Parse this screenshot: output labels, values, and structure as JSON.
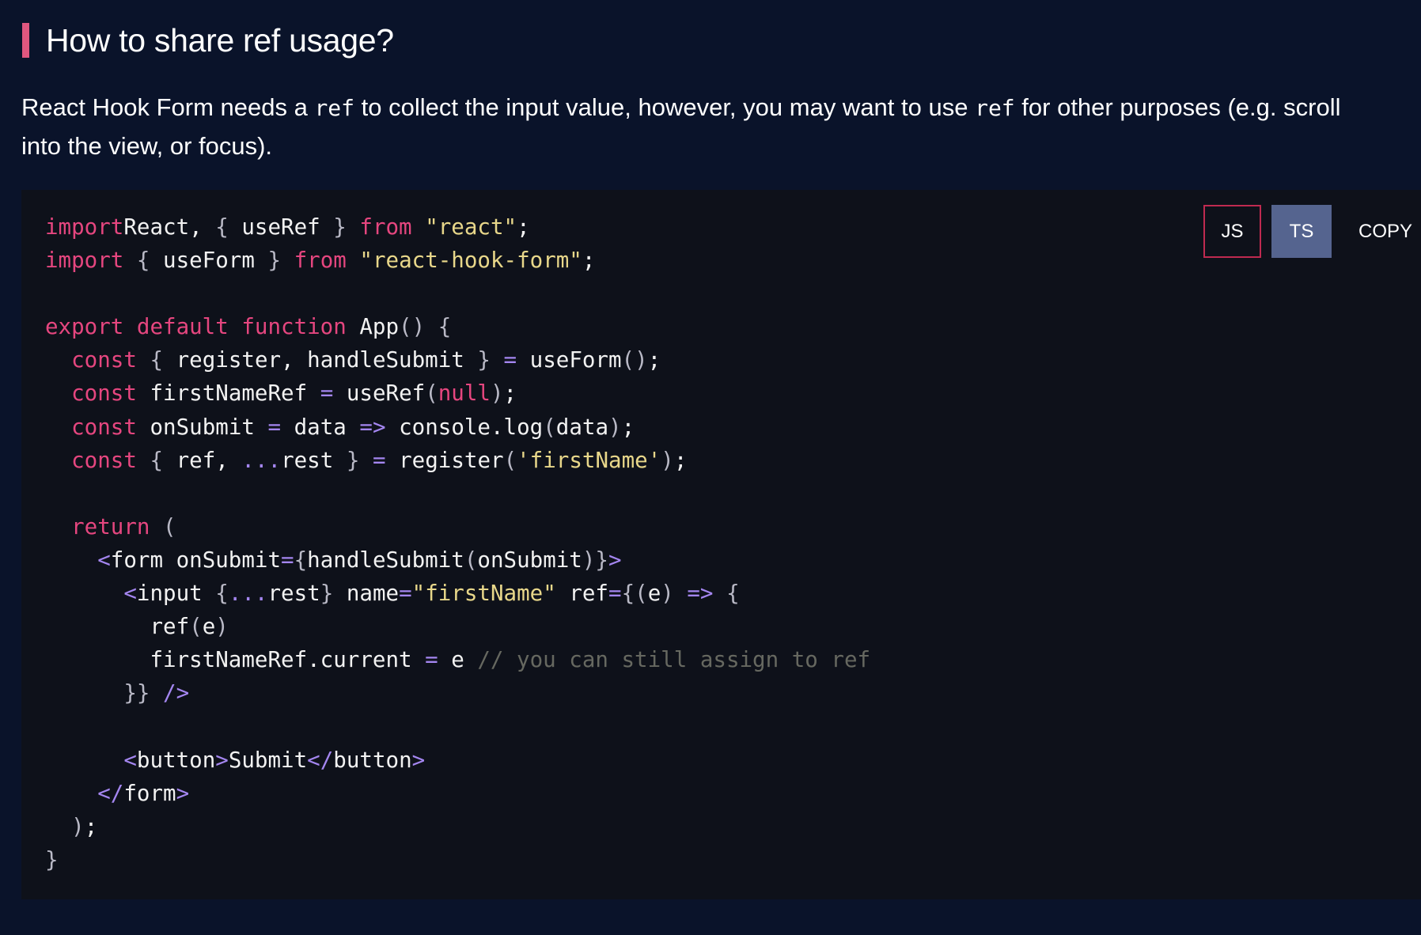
{
  "heading": "How to share ref usage?",
  "paragraph": {
    "line1_a": "React Hook Form needs a ",
    "code1": "ref",
    "line1_b": " to collect the input value, however, you may want to use ",
    "code2": "ref",
    "line1_c": " for other purposes (e.g. scroll",
    "line2": "into the view, or focus)."
  },
  "buttons": {
    "js": "JS",
    "ts": "TS",
    "copy": "COPY"
  },
  "colors": {
    "accent": "#e0577f",
    "keyword": "#e5467f",
    "string": "#e8d78a",
    "operator": "#a486f0",
    "ts_bg": "#55648f"
  },
  "code_lines": [
    [
      [
        "kw",
        "import"
      ],
      [
        "",
        "React, "
      ],
      [
        "pn",
        "{"
      ],
      [
        "",
        " useRef "
      ],
      [
        "pn",
        "}"
      ],
      [
        "",
        " "
      ],
      [
        "kw",
        "from"
      ],
      [
        "",
        " "
      ],
      [
        "str",
        "\"react\""
      ],
      [
        "",
        ";"
      ]
    ],
    [
      [
        "kw",
        "import"
      ],
      [
        "",
        " "
      ],
      [
        "pn",
        "{"
      ],
      [
        "",
        " useForm "
      ],
      [
        "pn",
        "}"
      ],
      [
        "",
        " "
      ],
      [
        "kw",
        "from"
      ],
      [
        "",
        " "
      ],
      [
        "str",
        "\"react-hook-form\""
      ],
      [
        "",
        ";"
      ]
    ],
    [],
    [
      [
        "kw",
        "export default function"
      ],
      [
        "",
        " App"
      ],
      [
        "pn",
        "()"
      ],
      [
        "",
        " "
      ],
      [
        "pn",
        "{"
      ]
    ],
    [
      [
        "",
        "  "
      ],
      [
        "kw",
        "const"
      ],
      [
        "",
        " "
      ],
      [
        "pn",
        "{"
      ],
      [
        "",
        " register, handleSubmit "
      ],
      [
        "pn",
        "}"
      ],
      [
        "",
        " "
      ],
      [
        "op",
        "="
      ],
      [
        "",
        " useForm"
      ],
      [
        "pn",
        "()"
      ],
      [
        "",
        ";"
      ]
    ],
    [
      [
        "",
        "  "
      ],
      [
        "kw",
        "const"
      ],
      [
        "",
        " firstNameRef "
      ],
      [
        "op",
        "="
      ],
      [
        "",
        " useRef"
      ],
      [
        "pn",
        "("
      ],
      [
        "kw",
        "null"
      ],
      [
        "pn",
        ")"
      ],
      [
        "",
        ";"
      ]
    ],
    [
      [
        "",
        "  "
      ],
      [
        "kw",
        "const"
      ],
      [
        "",
        " onSubmit "
      ],
      [
        "op",
        "="
      ],
      [
        "",
        " data "
      ],
      [
        "op",
        "=>"
      ],
      [
        "",
        " console.log"
      ],
      [
        "pn",
        "("
      ],
      [
        "",
        "data"
      ],
      [
        "pn",
        ")"
      ],
      [
        "",
        ";"
      ]
    ],
    [
      [
        "",
        "  "
      ],
      [
        "kw",
        "const"
      ],
      [
        "",
        " "
      ],
      [
        "pn",
        "{"
      ],
      [
        "",
        " ref, "
      ],
      [
        "op",
        "..."
      ],
      [
        "",
        "rest "
      ],
      [
        "pn",
        "}"
      ],
      [
        "",
        " "
      ],
      [
        "op",
        "="
      ],
      [
        "",
        " register"
      ],
      [
        "pn",
        "("
      ],
      [
        "str",
        "'firstName'"
      ],
      [
        "pn",
        ")"
      ],
      [
        "",
        ";"
      ]
    ],
    [],
    [
      [
        "",
        "  "
      ],
      [
        "kw",
        "return"
      ],
      [
        "",
        " "
      ],
      [
        "pn",
        "("
      ]
    ],
    [
      [
        "",
        "    "
      ],
      [
        "op",
        "<"
      ],
      [
        "",
        "form onSubmit"
      ],
      [
        "op",
        "="
      ],
      [
        "pn",
        "{"
      ],
      [
        "",
        "handleSubmit"
      ],
      [
        "pn",
        "("
      ],
      [
        "",
        "onSubmit"
      ],
      [
        "pn",
        ")"
      ],
      [
        "pn",
        "}"
      ],
      [
        "op",
        ">"
      ]
    ],
    [
      [
        "",
        "      "
      ],
      [
        "op",
        "<"
      ],
      [
        "",
        "input "
      ],
      [
        "pn",
        "{"
      ],
      [
        "op",
        "..."
      ],
      [
        "",
        "rest"
      ],
      [
        "pn",
        "}"
      ],
      [
        "",
        " name"
      ],
      [
        "op",
        "="
      ],
      [
        "str",
        "\"firstName\""
      ],
      [
        "",
        " ref"
      ],
      [
        "op",
        "="
      ],
      [
        "pn",
        "{("
      ],
      [
        "",
        "e"
      ],
      [
        "pn",
        ")"
      ],
      [
        "",
        " "
      ],
      [
        "op",
        "=>"
      ],
      [
        "",
        " "
      ],
      [
        "pn",
        "{"
      ]
    ],
    [
      [
        "",
        "        ref"
      ],
      [
        "pn",
        "("
      ],
      [
        "",
        "e"
      ],
      [
        "pn",
        ")"
      ]
    ],
    [
      [
        "",
        "        firstNameRef.current "
      ],
      [
        "op",
        "="
      ],
      [
        "",
        " e "
      ],
      [
        "cm",
        "// you can still assign to ref"
      ]
    ],
    [
      [
        "",
        "      "
      ],
      [
        "pn",
        "}}"
      ],
      [
        "",
        " "
      ],
      [
        "op",
        "/>"
      ]
    ],
    [],
    [
      [
        "",
        "      "
      ],
      [
        "op",
        "<"
      ],
      [
        "",
        "button"
      ],
      [
        "op",
        ">"
      ],
      [
        "",
        "Submit"
      ],
      [
        "op",
        "</"
      ],
      [
        "",
        "button"
      ],
      [
        "op",
        ">"
      ]
    ],
    [
      [
        "",
        "    "
      ],
      [
        "op",
        "</"
      ],
      [
        "",
        "form"
      ],
      [
        "op",
        ">"
      ]
    ],
    [
      [
        "",
        "  "
      ],
      [
        "pn",
        ")"
      ],
      [
        "",
        ";"
      ]
    ],
    [
      [
        "pn",
        "}"
      ]
    ]
  ]
}
